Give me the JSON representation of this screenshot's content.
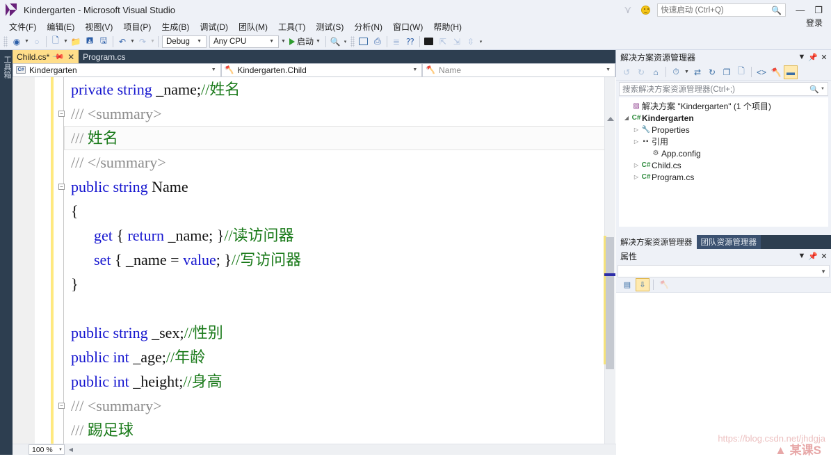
{
  "titlebar": {
    "app_title": "Kindergarten - Microsoft Visual Studio",
    "quick_launch_placeholder": "快速启动 (Ctrl+Q)",
    "sign_in": "登录",
    "minimize": "—",
    "restore": "❐"
  },
  "menu": {
    "items": [
      {
        "label": "文件(F)"
      },
      {
        "label": "编辑(E)"
      },
      {
        "label": "视图(V)"
      },
      {
        "label": "项目(P)"
      },
      {
        "label": "生成(B)"
      },
      {
        "label": "调试(D)"
      },
      {
        "label": "团队(M)"
      },
      {
        "label": "工具(T)"
      },
      {
        "label": "测试(S)"
      },
      {
        "label": "分析(N)"
      },
      {
        "label": "窗口(W)"
      },
      {
        "label": "帮助(H)"
      }
    ]
  },
  "toolbar": {
    "config_value": "Debug",
    "platform_value": "Any CPU",
    "run_label": "启动"
  },
  "left_strip": {
    "toolbox_label": "工具箱"
  },
  "editor": {
    "tabs": [
      {
        "label": "Child.cs*",
        "active": true
      },
      {
        "label": "Program.cs",
        "active": false
      }
    ],
    "nav_project": "Kindergarten",
    "nav_type": "Kindergarten.Child",
    "nav_member": "Name",
    "zoom_level": "100 %",
    "code_lines": [
      {
        "indent": 0,
        "tokens": [
          {
            "t": "private ",
            "c": "kw"
          },
          {
            "t": "string ",
            "c": "kw"
          },
          {
            "t": "_name;",
            "c": "id"
          },
          {
            "t": "//姓名",
            "c": "cm"
          }
        ]
      },
      {
        "indent": 0,
        "fold": true,
        "tokens": [
          {
            "t": "/// ",
            "c": "doc"
          },
          {
            "t": "<summary>",
            "c": "doc"
          }
        ]
      },
      {
        "indent": 0,
        "highlight": true,
        "tokens": [
          {
            "t": "/// ",
            "c": "doc"
          },
          {
            "t": "姓名",
            "c": "docg"
          }
        ]
      },
      {
        "indent": 0,
        "tokens": [
          {
            "t": "/// ",
            "c": "doc"
          },
          {
            "t": "</summary>",
            "c": "doc"
          }
        ]
      },
      {
        "indent": 0,
        "fold": true,
        "tokens": [
          {
            "t": "public ",
            "c": "kw"
          },
          {
            "t": "string ",
            "c": "kw"
          },
          {
            "t": "Name",
            "c": "id"
          }
        ]
      },
      {
        "indent": 0,
        "tokens": [
          {
            "t": "{",
            "c": "id"
          }
        ]
      },
      {
        "indent": 1,
        "tokens": [
          {
            "t": "get ",
            "c": "kw"
          },
          {
            "t": "{ ",
            "c": "id"
          },
          {
            "t": "return ",
            "c": "kw"
          },
          {
            "t": "_name; }",
            "c": "id"
          },
          {
            "t": "//读访问器",
            "c": "cm"
          }
        ]
      },
      {
        "indent": 1,
        "tokens": [
          {
            "t": "set ",
            "c": "kw"
          },
          {
            "t": "{ _name = ",
            "c": "id"
          },
          {
            "t": "value",
            "c": "kw"
          },
          {
            "t": "; }",
            "c": "id"
          },
          {
            "t": "//写访问器",
            "c": "cm"
          }
        ]
      },
      {
        "indent": 0,
        "tokens": [
          {
            "t": "}",
            "c": "id"
          }
        ]
      },
      {
        "indent": 0,
        "tokens": []
      },
      {
        "indent": 0,
        "tokens": [
          {
            "t": "public ",
            "c": "kw"
          },
          {
            "t": "string ",
            "c": "kw"
          },
          {
            "t": "_sex;",
            "c": "id"
          },
          {
            "t": "//性别",
            "c": "cm"
          }
        ]
      },
      {
        "indent": 0,
        "tokens": [
          {
            "t": "public ",
            "c": "kw"
          },
          {
            "t": "int ",
            "c": "kw"
          },
          {
            "t": "_age;",
            "c": "id"
          },
          {
            "t": "//年龄",
            "c": "cm"
          }
        ]
      },
      {
        "indent": 0,
        "tokens": [
          {
            "t": "public ",
            "c": "kw"
          },
          {
            "t": "int ",
            "c": "kw"
          },
          {
            "t": "_height;",
            "c": "id"
          },
          {
            "t": "//身高",
            "c": "cm"
          }
        ]
      },
      {
        "indent": 0,
        "fold": true,
        "tokens": [
          {
            "t": "/// ",
            "c": "doc"
          },
          {
            "t": "<summary>",
            "c": "doc"
          }
        ]
      },
      {
        "indent": 0,
        "tokens": [
          {
            "t": "/// ",
            "c": "doc"
          },
          {
            "t": "踢足球",
            "c": "docg"
          }
        ]
      }
    ]
  },
  "solution_explorer": {
    "title": "解决方案资源管理器",
    "search_placeholder": "搜索解决方案资源管理器(Ctrl+;)",
    "tree": [
      {
        "depth": 0,
        "expander": "",
        "icon": "solution-icon",
        "glyph": "▨",
        "label": "解决方案 \"Kindergarten\" (1 个项目)",
        "bold": false
      },
      {
        "depth": 0,
        "expander": "◢",
        "icon": "csproj-icon",
        "glyph": "C#",
        "label": "Kindergarten",
        "bold": true
      },
      {
        "depth": 1,
        "expander": "▷",
        "icon": "properties-icon",
        "glyph": "🔧",
        "label": "Properties",
        "bold": false
      },
      {
        "depth": 1,
        "expander": "▷",
        "icon": "references-icon",
        "glyph": "▪▪",
        "label": "引用",
        "bold": false
      },
      {
        "depth": 2,
        "expander": "",
        "icon": "config-file-icon",
        "glyph": "⚙",
        "label": "App.config",
        "bold": false
      },
      {
        "depth": 1,
        "expander": "▷",
        "icon": "csfile-icon",
        "glyph": "C#",
        "label": "Child.cs",
        "bold": false
      },
      {
        "depth": 1,
        "expander": "▷",
        "icon": "csfile-icon",
        "glyph": "C#",
        "label": "Program.cs",
        "bold": false
      }
    ],
    "dock_tabs": [
      {
        "label": "解决方案资源管理器",
        "active": true
      },
      {
        "label": "团队资源管理器",
        "active": false
      }
    ]
  },
  "properties_panel": {
    "title": "属性"
  },
  "watermark": {
    "url": "https://blog.csdn.net/jhdgja",
    "logo": "▲ 某课S"
  }
}
